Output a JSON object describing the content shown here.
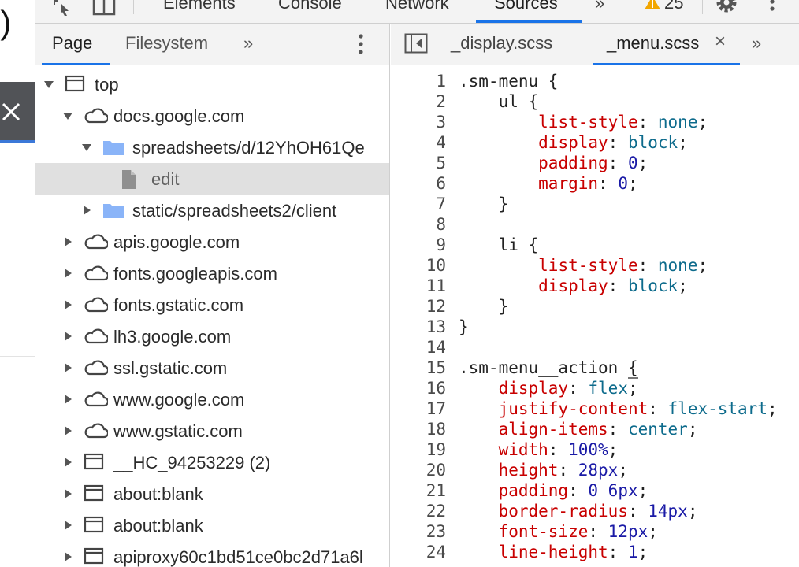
{
  "top_toolbar": {
    "tabs": [
      {
        "label": "Elements",
        "active": false
      },
      {
        "label": "Console",
        "active": false
      },
      {
        "label": "Network",
        "active": false
      },
      {
        "label": "Sources",
        "active": true
      }
    ],
    "more_glyph": "»",
    "warning_count": "25"
  },
  "navigator": {
    "tabs": [
      {
        "label": "Page",
        "active": true
      },
      {
        "label": "Filesystem",
        "active": false
      }
    ],
    "more_glyph": "»",
    "tree": [
      {
        "label": "top",
        "icon": "frame-icon",
        "expanded": true,
        "level": 0,
        "selected": false
      },
      {
        "label": "docs.google.com",
        "icon": "cloud-icon",
        "expanded": true,
        "level": 1,
        "selected": false
      },
      {
        "label": "spreadsheets/d/12YhOH61Qe",
        "icon": "folder-icon",
        "expanded": true,
        "level": 2,
        "selected": false
      },
      {
        "label": "edit",
        "icon": "file-icon",
        "expanded": null,
        "level": 3,
        "selected": true
      },
      {
        "label": "static/spreadsheets2/client",
        "icon": "folder-icon",
        "expanded": false,
        "level": 2,
        "selected": false
      },
      {
        "label": "apis.google.com",
        "icon": "cloud-icon",
        "expanded": false,
        "level": 1,
        "selected": false
      },
      {
        "label": "fonts.googleapis.com",
        "icon": "cloud-icon",
        "expanded": false,
        "level": 1,
        "selected": false
      },
      {
        "label": "fonts.gstatic.com",
        "icon": "cloud-icon",
        "expanded": false,
        "level": 1,
        "selected": false
      },
      {
        "label": "lh3.google.com",
        "icon": "cloud-icon",
        "expanded": false,
        "level": 1,
        "selected": false
      },
      {
        "label": "ssl.gstatic.com",
        "icon": "cloud-icon",
        "expanded": false,
        "level": 1,
        "selected": false
      },
      {
        "label": "www.google.com",
        "icon": "cloud-icon",
        "expanded": false,
        "level": 1,
        "selected": false
      },
      {
        "label": "www.gstatic.com",
        "icon": "cloud-icon",
        "expanded": false,
        "level": 1,
        "selected": false
      },
      {
        "label": "__HC_94253229 (2)",
        "icon": "frame-icon",
        "expanded": false,
        "level": 1,
        "selected": false
      },
      {
        "label": "about:blank",
        "icon": "frame-icon",
        "expanded": false,
        "level": 1,
        "selected": false
      },
      {
        "label": "about:blank",
        "icon": "frame-icon",
        "expanded": false,
        "level": 1,
        "selected": false
      },
      {
        "label": "apiproxy60c1bd51ce0bc2d71a6l",
        "icon": "frame-icon",
        "expanded": false,
        "level": 1,
        "selected": false
      }
    ]
  },
  "editor": {
    "tabs": [
      {
        "label": "_display.scss",
        "active": false
      },
      {
        "label": "_menu.scss",
        "active": true
      }
    ],
    "close_glyph": "×",
    "more_glyph": "»",
    "lines": [
      {
        "num": "1",
        "tokens": [
          {
            "t": ".sm-menu {",
            "c": "sel"
          }
        ]
      },
      {
        "num": "2",
        "tokens": [
          {
            "t": "    ul {",
            "c": "sel"
          }
        ]
      },
      {
        "num": "3",
        "tokens": [
          {
            "t": "        ",
            "c": "punc"
          },
          {
            "t": "list-style",
            "c": "prop"
          },
          {
            "t": ": ",
            "c": "punc"
          },
          {
            "t": "none",
            "c": "kw"
          },
          {
            "t": ";",
            "c": "punc"
          }
        ]
      },
      {
        "num": "4",
        "tokens": [
          {
            "t": "        ",
            "c": "punc"
          },
          {
            "t": "display",
            "c": "prop"
          },
          {
            "t": ": ",
            "c": "punc"
          },
          {
            "t": "block",
            "c": "kw"
          },
          {
            "t": ";",
            "c": "punc"
          }
        ]
      },
      {
        "num": "5",
        "tokens": [
          {
            "t": "        ",
            "c": "punc"
          },
          {
            "t": "padding",
            "c": "prop"
          },
          {
            "t": ": ",
            "c": "punc"
          },
          {
            "t": "0",
            "c": "val"
          },
          {
            "t": ";",
            "c": "punc"
          }
        ]
      },
      {
        "num": "6",
        "tokens": [
          {
            "t": "        ",
            "c": "punc"
          },
          {
            "t": "margin",
            "c": "prop"
          },
          {
            "t": ": ",
            "c": "punc"
          },
          {
            "t": "0",
            "c": "val"
          },
          {
            "t": ";",
            "c": "punc"
          }
        ]
      },
      {
        "num": "7",
        "tokens": [
          {
            "t": "    }",
            "c": "punc"
          }
        ]
      },
      {
        "num": "8",
        "tokens": []
      },
      {
        "num": "9",
        "tokens": [
          {
            "t": "    li {",
            "c": "sel"
          }
        ]
      },
      {
        "num": "10",
        "tokens": [
          {
            "t": "        ",
            "c": "punc"
          },
          {
            "t": "list-style",
            "c": "prop"
          },
          {
            "t": ": ",
            "c": "punc"
          },
          {
            "t": "none",
            "c": "kw"
          },
          {
            "t": ";",
            "c": "punc"
          }
        ]
      },
      {
        "num": "11",
        "tokens": [
          {
            "t": "        ",
            "c": "punc"
          },
          {
            "t": "display",
            "c": "prop"
          },
          {
            "t": ": ",
            "c": "punc"
          },
          {
            "t": "block",
            "c": "kw"
          },
          {
            "t": ";",
            "c": "punc"
          }
        ]
      },
      {
        "num": "12",
        "tokens": [
          {
            "t": "    }",
            "c": "punc"
          }
        ]
      },
      {
        "num": "13",
        "tokens": [
          {
            "t": "}",
            "c": "punc"
          }
        ]
      },
      {
        "num": "14",
        "tokens": []
      },
      {
        "num": "15",
        "tokens": [
          {
            "t": ".sm-menu__action ",
            "c": "sel"
          },
          {
            "t": "{",
            "c": "brace-hl"
          }
        ]
      },
      {
        "num": "16",
        "tokens": [
          {
            "t": "    ",
            "c": "punc"
          },
          {
            "t": "display",
            "c": "prop"
          },
          {
            "t": ": ",
            "c": "punc"
          },
          {
            "t": "flex",
            "c": "kw"
          },
          {
            "t": ";",
            "c": "punc"
          }
        ]
      },
      {
        "num": "17",
        "tokens": [
          {
            "t": "    ",
            "c": "punc"
          },
          {
            "t": "justify-content",
            "c": "prop"
          },
          {
            "t": ": ",
            "c": "punc"
          },
          {
            "t": "flex-start",
            "c": "kw"
          },
          {
            "t": ";",
            "c": "punc"
          }
        ]
      },
      {
        "num": "18",
        "tokens": [
          {
            "t": "    ",
            "c": "punc"
          },
          {
            "t": "align-items",
            "c": "prop"
          },
          {
            "t": ": ",
            "c": "punc"
          },
          {
            "t": "center",
            "c": "kw"
          },
          {
            "t": ";",
            "c": "punc"
          }
        ]
      },
      {
        "num": "19",
        "tokens": [
          {
            "t": "    ",
            "c": "punc"
          },
          {
            "t": "width",
            "c": "prop"
          },
          {
            "t": ": ",
            "c": "punc"
          },
          {
            "t": "100%",
            "c": "val"
          },
          {
            "t": ";",
            "c": "punc"
          }
        ]
      },
      {
        "num": "20",
        "tokens": [
          {
            "t": "    ",
            "c": "punc"
          },
          {
            "t": "height",
            "c": "prop"
          },
          {
            "t": ": ",
            "c": "punc"
          },
          {
            "t": "28px",
            "c": "val"
          },
          {
            "t": ";",
            "c": "punc"
          }
        ]
      },
      {
        "num": "21",
        "tokens": [
          {
            "t": "    ",
            "c": "punc"
          },
          {
            "t": "padding",
            "c": "prop"
          },
          {
            "t": ": ",
            "c": "punc"
          },
          {
            "t": "0 6px",
            "c": "val"
          },
          {
            "t": ";",
            "c": "punc"
          }
        ]
      },
      {
        "num": "22",
        "tokens": [
          {
            "t": "    ",
            "c": "punc"
          },
          {
            "t": "border-radius",
            "c": "prop"
          },
          {
            "t": ": ",
            "c": "punc"
          },
          {
            "t": "14px",
            "c": "val"
          },
          {
            "t": ";",
            "c": "punc"
          }
        ]
      },
      {
        "num": "23",
        "tokens": [
          {
            "t": "    ",
            "c": "punc"
          },
          {
            "t": "font-size",
            "c": "prop"
          },
          {
            "t": ": ",
            "c": "punc"
          },
          {
            "t": "12px",
            "c": "val"
          },
          {
            "t": ";",
            "c": "punc"
          }
        ]
      },
      {
        "num": "24",
        "tokens": [
          {
            "t": "    ",
            "c": "punc"
          },
          {
            "t": "line-height",
            "c": "prop"
          },
          {
            "t": ": ",
            "c": "punc"
          },
          {
            "t": "1",
            "c": "val"
          },
          {
            "t": ";",
            "c": "punc"
          }
        ]
      }
    ]
  }
}
